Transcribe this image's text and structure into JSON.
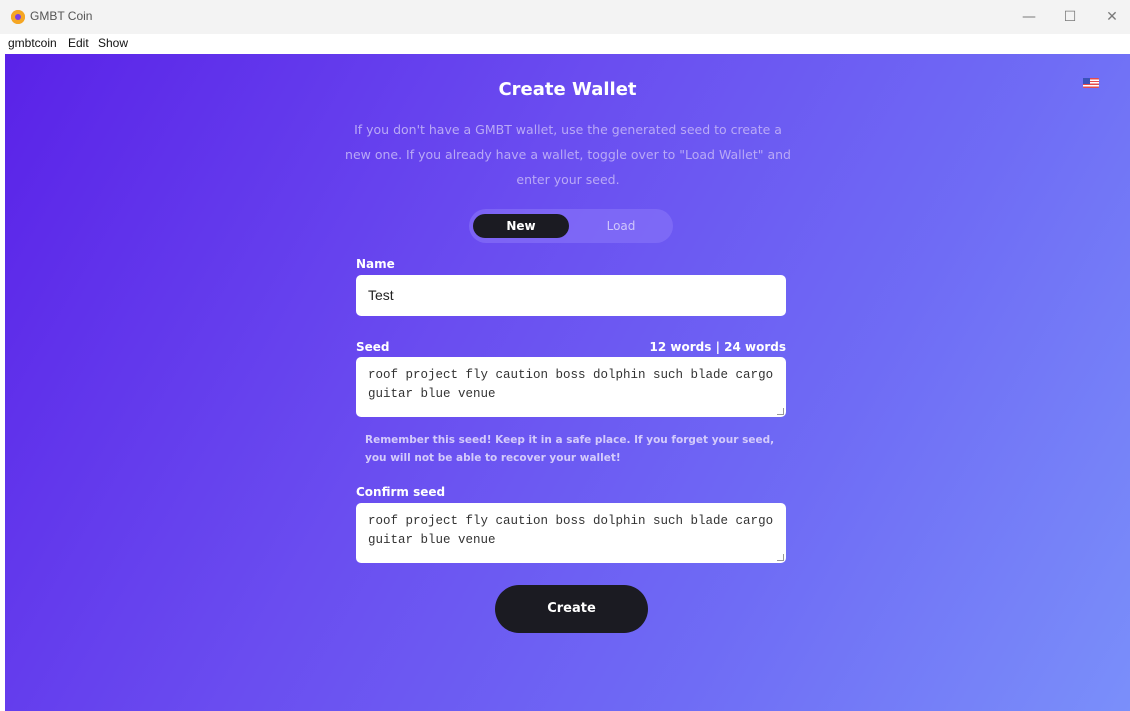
{
  "window": {
    "title": "GMBT Coin",
    "controls": {
      "minimize": "—",
      "maximize": "☐",
      "close": "✕"
    }
  },
  "menu": {
    "items": [
      "gmbtcoin",
      "Edit",
      "Show"
    ]
  },
  "page": {
    "language_flag": "us-flag-icon",
    "heading": "Create Wallet",
    "description": "If you don't have a GMBT wallet, use the generated seed to create a new one. If you already have a wallet, toggle over to \"Load Wallet\" and enter your seed.",
    "toggle": {
      "new_label": "New",
      "load_label": "Load",
      "selected": "New"
    },
    "name": {
      "label": "Name",
      "value": "Test"
    },
    "seed": {
      "label": "Seed",
      "word_options": "12 words | 24 words",
      "value": "roof project fly caution boss dolphin such blade cargo guitar blue venue"
    },
    "warning": "Remember this seed! Keep it in a safe place. If you forget your seed, you will not be able to recover your wallet!",
    "confirm_seed": {
      "label": "Confirm seed",
      "value": "roof project fly caution boss dolphin such blade cargo guitar blue venue"
    },
    "create_button": "Create"
  },
  "colors": {
    "gradient_start": "#5a22e8",
    "gradient_end": "#7a8ffa",
    "button_dark": "#1b1b22"
  }
}
